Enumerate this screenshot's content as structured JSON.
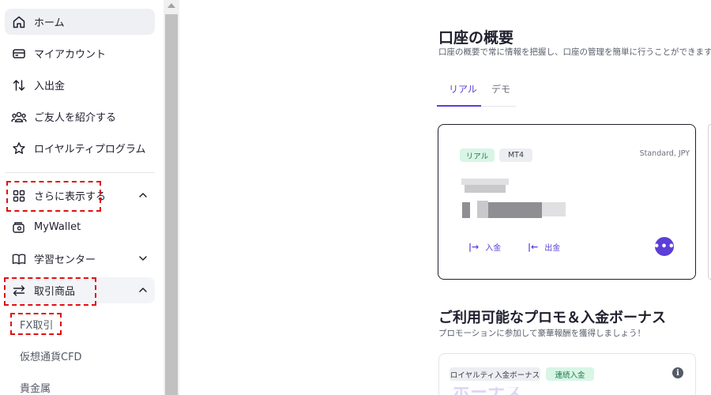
{
  "sidebar": {
    "home": "ホーム",
    "my_account": "マイアカウント",
    "deposit_withdraw": "入出金",
    "refer_friend": "ご友人を紹介する",
    "loyalty": "ロイヤルティプログラム",
    "show_more": "さらに表示する",
    "mywallet": "MyWallet",
    "learning": "学習センター",
    "products": "取引商品",
    "sub_fx": "FX取引",
    "sub_crypto": "仮想通貨CFD",
    "sub_metals": "貴金属"
  },
  "overview": {
    "title": "口座の概要",
    "subtitle": "口座の概要で常に情報を把握し、口座の管理を簡単に行うことができます。"
  },
  "tabs": {
    "real": "リアル",
    "demo": "デモ"
  },
  "account_card": {
    "badge_type": "リアル",
    "badge_platform": "MT4",
    "meta": "Standard, JPY",
    "deposit": "入金",
    "withdraw": "出金",
    "more_glyph": "•••"
  },
  "promos": {
    "title": "ご利用可能なプロモ＆入金ボーナス",
    "subtitle": "プロモーションに参加して豪華報酬を獲得しましょう！",
    "badge_loyalty": "ロイヤルティ入金ボーナス",
    "badge_consecutive": "連続入金",
    "teaser": "ボーナス",
    "info_glyph": "i"
  },
  "colors": {
    "accent": "#5b3fd6",
    "highlight": "#e01010",
    "badge_green": "#d9f5e6"
  },
  "icons": {
    "home": "home-icon",
    "account": "credit-card-icon",
    "transfer": "arrows-up-down-icon",
    "refer": "users-icon",
    "loyalty": "star-icon",
    "more": "grid-icon",
    "wallet": "wallet-icon",
    "learning": "book-icon",
    "products": "arrows-swap-icon"
  }
}
